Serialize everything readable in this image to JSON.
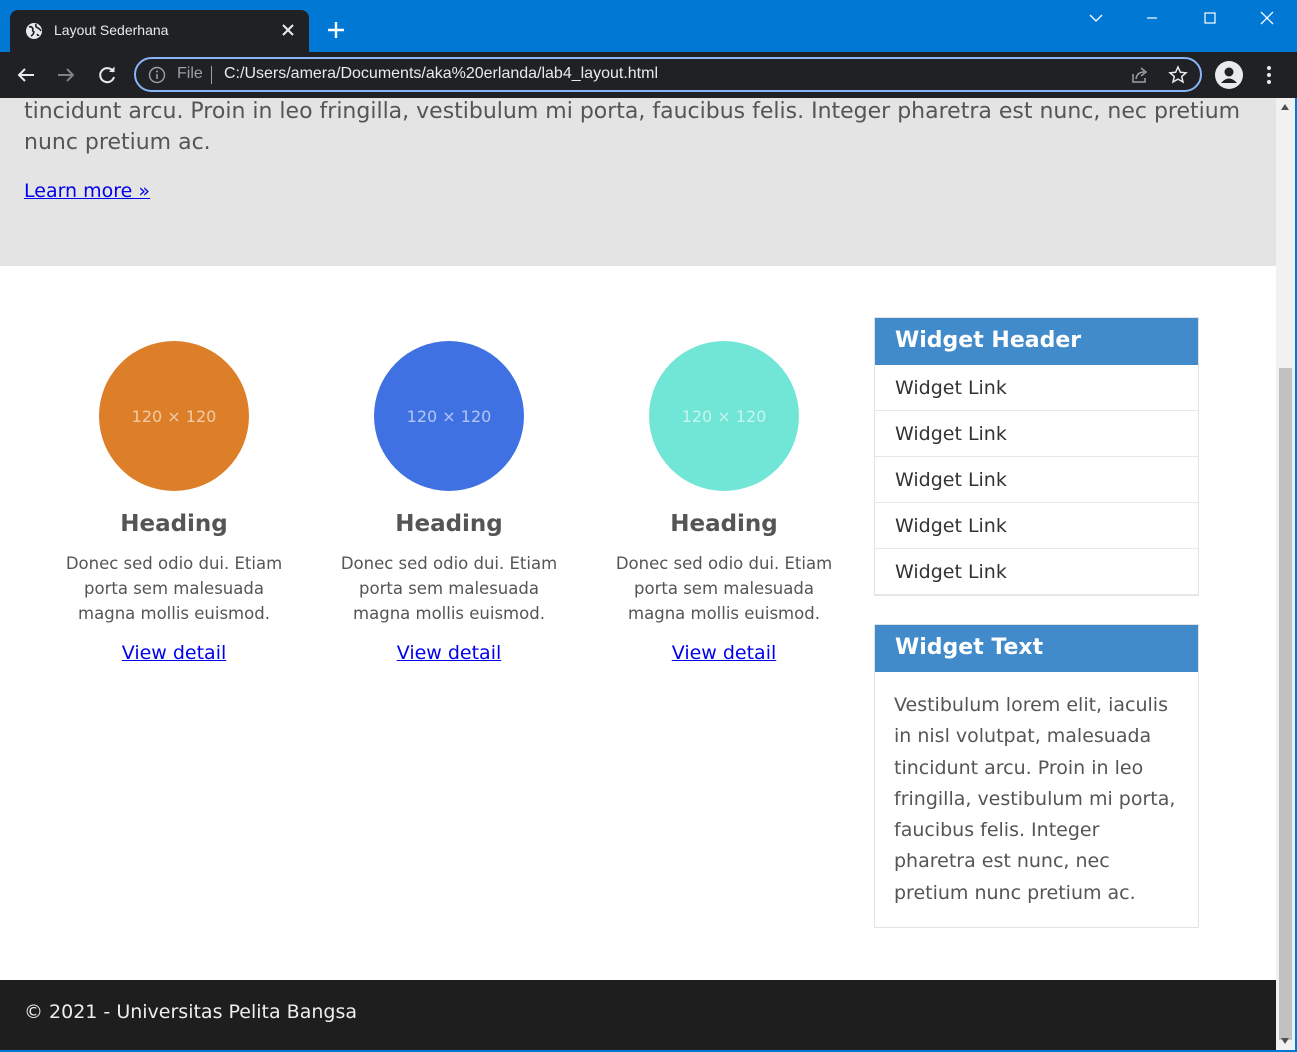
{
  "browser": {
    "tab_title": "Layout Sederhana",
    "url_scheme": "File",
    "url": "C:/Users/amera/Documents/aka%20erlanda/lab4_layout.html",
    "titlebar_color": "#0078d4",
    "toolbar_color": "#202124",
    "focus_ring_color": "#8ab4f8"
  },
  "hero": {
    "text": "tincidunt arcu. Proin in leo fringilla, vestibulum mi porta, faucibus felis. Integer pharetra est nunc, nec pretium nunc pretium ac.",
    "link": "Learn more »",
    "background": "#e4e4e4"
  },
  "features": [
    {
      "image_label": "120 × 120",
      "color": "#dd7e29",
      "heading": "Heading",
      "text": "Donec sed odio dui. Etiam porta sem malesuada magna mollis euismod.",
      "link": "View detail"
    },
    {
      "image_label": "120 × 120",
      "color": "#3f71e2",
      "heading": "Heading",
      "text": "Donec sed odio dui. Etiam porta sem malesuada magna mollis euismod.",
      "link": "View detail"
    },
    {
      "image_label": "120 × 120",
      "color": "#71e6d7",
      "heading": "Heading",
      "text": "Donec sed odio dui. Etiam porta sem malesuada magna mollis euismod.",
      "link": "View detail"
    }
  ],
  "widget_links": {
    "header": "Widget Header",
    "header_color": "#428bca",
    "links": [
      "Widget Link",
      "Widget Link",
      "Widget Link",
      "Widget Link",
      "Widget Link"
    ]
  },
  "widget_text": {
    "header": "Widget Text",
    "body": "Vestibulum lorem elit, iaculis in nisl volutpat, malesuada tincidunt arcu. Proin in leo fringilla, vestibulum mi porta, faucibus felis. Integer pharetra est nunc, nec pretium nunc pretium ac."
  },
  "footer": {
    "text": "© 2021 - Universitas Pelita Bangsa",
    "background": "#1e1e1e"
  }
}
